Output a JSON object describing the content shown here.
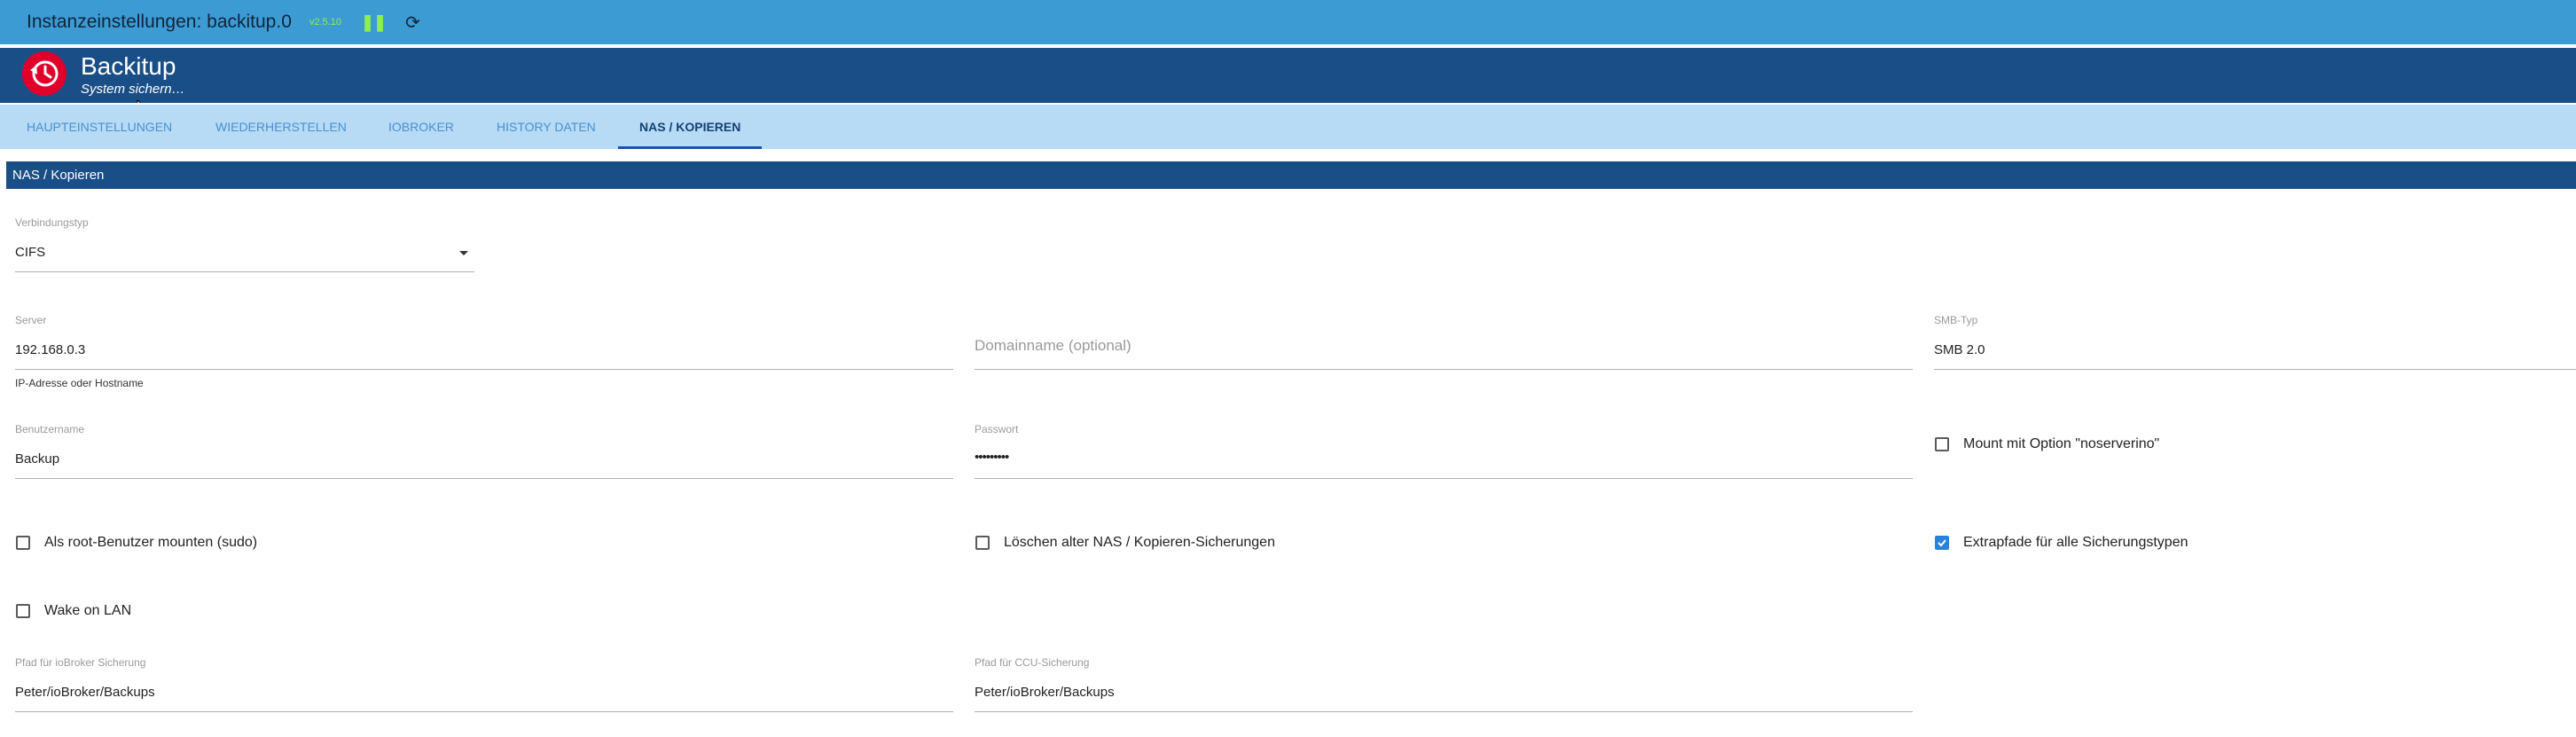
{
  "window": {
    "title": "Instanzeinstellungen: backitup.0",
    "version": "v2.5.10"
  },
  "header": {
    "app_name": "Backitup",
    "subtitle": "System sichern…"
  },
  "tabs": [
    {
      "label": "Haupteinstellungen",
      "active": false
    },
    {
      "label": "Wiederherstellen",
      "active": false
    },
    {
      "label": "ioBroker",
      "active": false
    },
    {
      "label": "History Daten",
      "active": false
    },
    {
      "label": "NAS / Kopieren",
      "active": true
    }
  ],
  "section": {
    "title": "NAS / Kopieren"
  },
  "form": {
    "connection_type": {
      "label": "Verbindungstyp",
      "value": "CIFS"
    },
    "server": {
      "label": "Server",
      "value": "192.168.0.3",
      "helper": "IP-Adresse oder Hostname"
    },
    "domain": {
      "placeholder": "Domainname (optional)"
    },
    "smb_type": {
      "label": "SMB-Typ",
      "value": "SMB 2.0"
    },
    "username": {
      "label": "Benutzername",
      "value": "Backup"
    },
    "password": {
      "label": "Passwort",
      "value": "•••••••••"
    },
    "noserverino": {
      "label": "Mount mit Option \"noserverino\"",
      "checked": false
    },
    "sudo": {
      "label": "Als root-Benutzer mounten (sudo)",
      "checked": false
    },
    "delete_old": {
      "label": "Löschen alter NAS / Kopieren-Sicherungen",
      "checked": false
    },
    "extra_paths": {
      "label": "Extrapfade für alle Sicherungstypen",
      "checked": true
    },
    "wake_on_lan": {
      "label": "Wake on LAN",
      "checked": false
    },
    "iobroker_path": {
      "label": "Pfad für ioBroker Sicherung",
      "value": "Peter/ioBroker/Backups"
    },
    "ccu_path": {
      "label": "Pfad für CCU-Sicherung",
      "value": "Peter/ioBroker/Backups"
    }
  },
  "colors": {
    "title_bar": "#3d9bd4",
    "header": "#1a4e86",
    "tab_bar": "#b7daf5",
    "logo": "#e0002a",
    "version_text": "#8ef04a",
    "checkbox_checked": "#2b83d8"
  }
}
